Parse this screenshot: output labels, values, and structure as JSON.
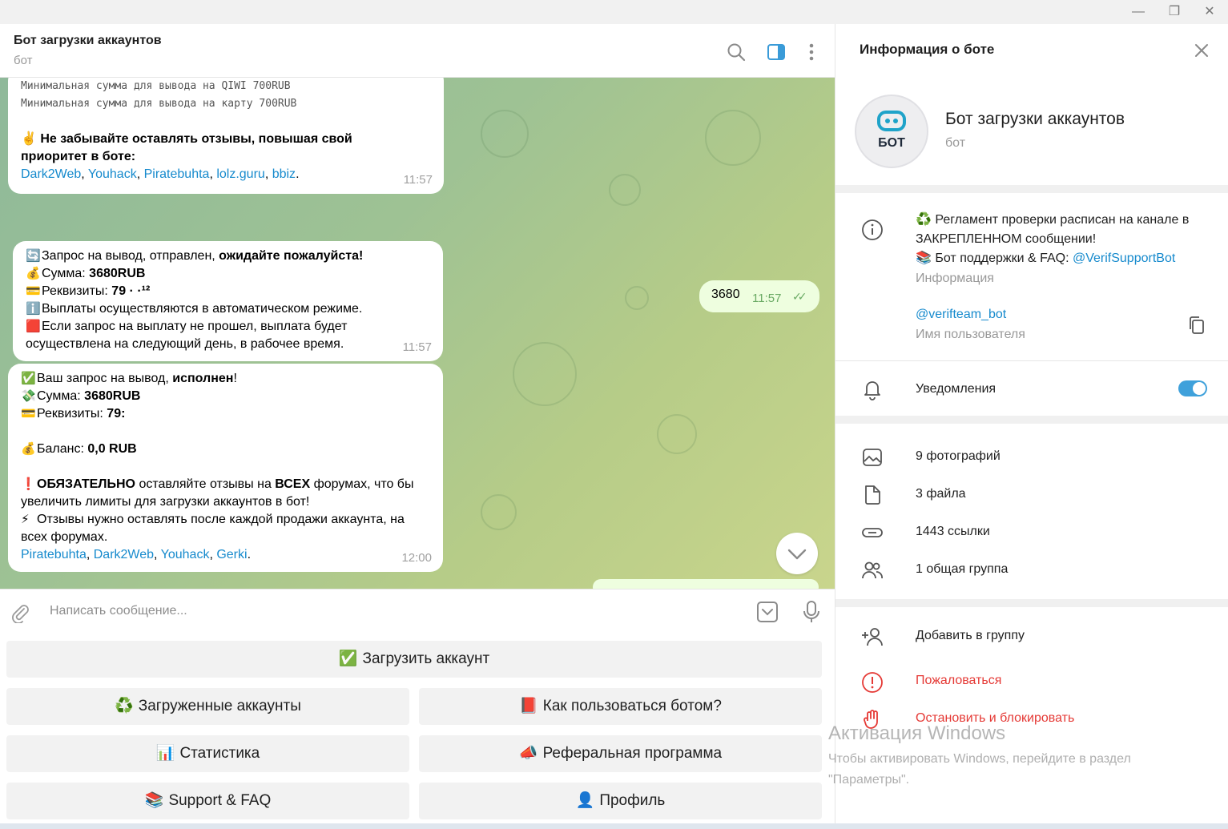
{
  "window": {
    "minimize": "—",
    "restore": "❐",
    "close": "✕"
  },
  "chat": {
    "title": "Бот загрузки аккаунтов",
    "subtitle": "бот"
  },
  "messages": {
    "m1": {
      "line1": "Минимальная сумма для вывода на QIWI 700RUB",
      "line2": "Минимальная сумма для вывода на карту 700RUB",
      "emoji": "✌️",
      "bold": "Не забывайте оставлять отзывы, повышая свой приоритет в боте:",
      "links": [
        "Dark2Web",
        "Youhack",
        "Piratebuhta",
        "lolz.guru",
        "bbiz"
      ],
      "time": "11:57"
    },
    "out": {
      "text": "3680",
      "time": "11:57",
      "ticks": "✓✓"
    },
    "m2": {
      "l1a": "Запрос на вывод,  отправлен, ",
      "l1b": "ожидайте пожалуйста!",
      "l2a": "Сумма: ",
      "l2b": "3680RUB",
      "l3a": "Реквизиты: ",
      "l3b": "79 · ·¹²",
      "l4": "Выплаты осуществляются в автоматическом режиме.",
      "l5": "Если запрос на выплату не прошел, выплата будет осуществлена на следующий день, в рабочее время.",
      "time": "11:57"
    },
    "m3": {
      "l1a": "Ваш запрос на вывод, ",
      "l1b": "исполнен",
      "l1c": "!",
      "l2a": "Сумма: ",
      "l2b": "3680RUB",
      "l3a": "Реквизиты: ",
      "l3b": "79:",
      "l4a": "Баланс: ",
      "l4b": "0,0 RUB",
      "l5a": "ОБЯЗАТЕЛЬНО",
      "l5b": " оставляйте отзывы на ",
      "l5c": "ВСЕХ",
      "l5d": " форумах, что бы увеличить лимиты для загрузки аккаунтов в бот!",
      "l6": "Отзывы нужно оставлять после каждой продажи аккаунта, на всех форумах.",
      "links": [
        "Piratebuhta",
        "Dark2Web",
        "Youhack",
        "Gerki"
      ],
      "time": "12:00"
    }
  },
  "input": {
    "placeholder": "Написать сообщение..."
  },
  "keyboard": {
    "upload": {
      "icon": "✅",
      "label": "Загрузить аккаунт"
    },
    "uploaded": {
      "icon": "♻️",
      "label": "Загруженные аккаунты"
    },
    "howto": {
      "icon": "📕",
      "label": "Как пользоваться ботом?"
    },
    "stats": {
      "icon": "📊",
      "label": "Статистика"
    },
    "referral": {
      "icon": "📣",
      "label": "Реферальная программа"
    },
    "support": {
      "icon": "📚",
      "label": "Support & FAQ"
    },
    "profile": {
      "icon": "👤",
      "label": "Профиль"
    }
  },
  "panel": {
    "title": "Информация о боте",
    "avatar_text": "БОТ",
    "name": "Бот загрузки аккаунтов",
    "sub": "бот",
    "info_line1": "♻️ Регламент проверки расписан на канале в ЗАКРЕПЛЕННОМ сообщении!",
    "info_line2a": "📚 Бот поддержки & FAQ: ",
    "info_line2b": "@VerifSupportBot",
    "info_label": "Информация",
    "username": "@verifteam_bot",
    "username_label": "Имя пользователя",
    "notifications": "Уведомления",
    "photos": "9 фотографий",
    "files": "3 файла",
    "links": "1443 ссылки",
    "groups": "1 общая группа",
    "add_group": "Добавить в группу",
    "report": "Пожаловаться",
    "block": "Остановить и блокировать"
  },
  "watermark": {
    "title": "Активация Windows",
    "text": "Чтобы активировать Windows, перейдите в раздел \"Параметры\"."
  }
}
